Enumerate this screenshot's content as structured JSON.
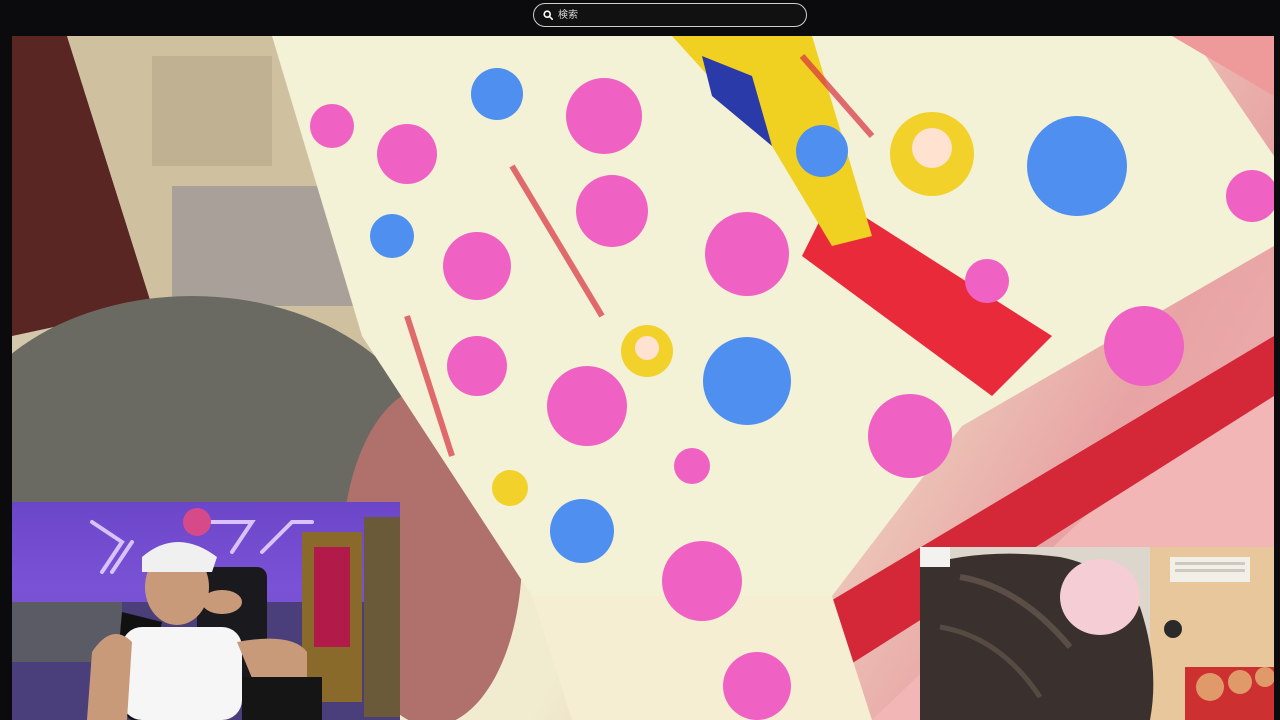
{
  "search": {
    "placeholder": "検索"
  },
  "main_video": {
    "subject": "patterned-gift-box"
  },
  "pip_left": {
    "subject": "streamer-webcam"
  },
  "pip_right": {
    "subject": "secondary-camera-feed"
  },
  "colors": {
    "topbar": "#0b0b0d",
    "search_border": "#cfcfcf",
    "pink_flower": "#ef62c4",
    "blue_flower": "#4f8ff0",
    "box_cream": "#f3f1d6",
    "accent_red": "#e02a3a"
  }
}
